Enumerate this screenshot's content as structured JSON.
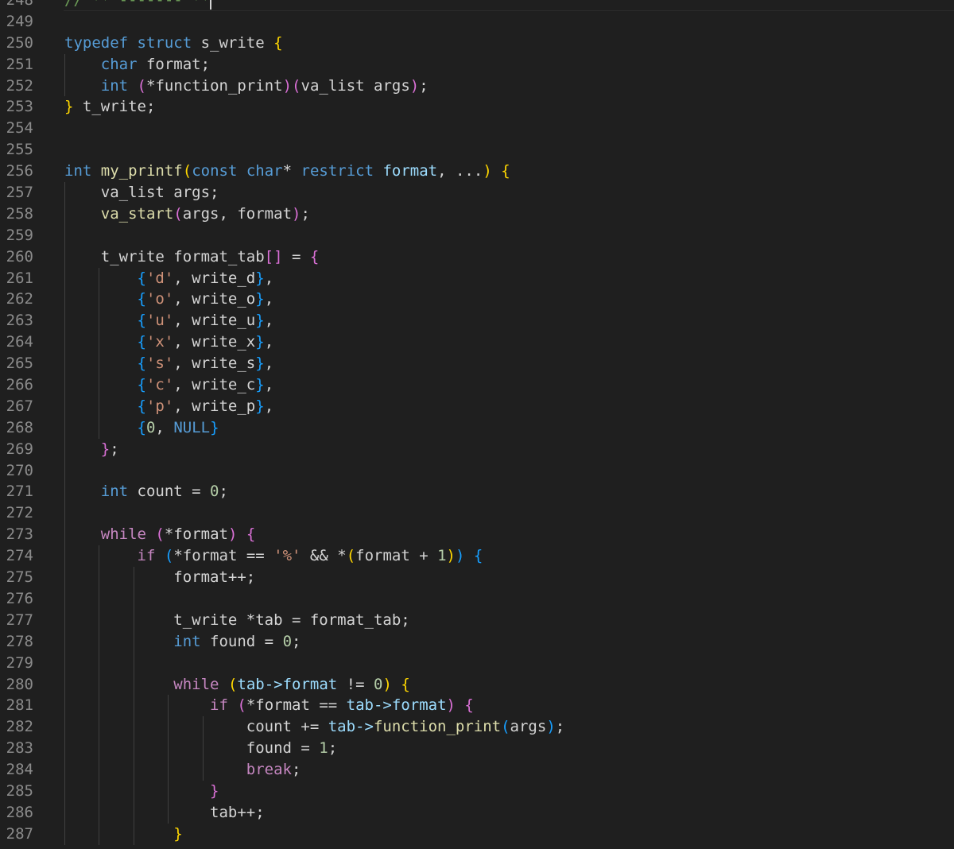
{
  "editor": {
    "language": "c",
    "cursor_line": "248",
    "lines": [
      {
        "num": "248",
        "indent": 0,
        "tokens": [
          {
            "t": "// ** ------- **",
            "c": "cm"
          }
        ]
      },
      {
        "num": "249",
        "indent": 0,
        "tokens": []
      },
      {
        "num": "250",
        "indent": 0,
        "tokens": [
          {
            "t": "typedef",
            "c": "kw"
          },
          {
            "t": " "
          },
          {
            "t": "struct",
            "c": "kw"
          },
          {
            "t": " s_write "
          },
          {
            "t": "{",
            "c": "br1"
          }
        ]
      },
      {
        "num": "251",
        "indent": 1,
        "tokens": [
          {
            "t": "char",
            "c": "kw"
          },
          {
            "t": " format;"
          }
        ]
      },
      {
        "num": "252",
        "indent": 1,
        "tokens": [
          {
            "t": "int",
            "c": "kw"
          },
          {
            "t": " "
          },
          {
            "t": "(",
            "c": "br2"
          },
          {
            "t": "*function_print"
          },
          {
            "t": ")",
            "c": "br2"
          },
          {
            "t": "(",
            "c": "br2"
          },
          {
            "t": "va_list args"
          },
          {
            "t": ")",
            "c": "br2"
          },
          {
            "t": ";"
          }
        ]
      },
      {
        "num": "253",
        "indent": 0,
        "tokens": [
          {
            "t": "}",
            "c": "br1"
          },
          {
            "t": " t_write;"
          }
        ]
      },
      {
        "num": "254",
        "indent": 0,
        "tokens": []
      },
      {
        "num": "255",
        "indent": 0,
        "tokens": []
      },
      {
        "num": "256",
        "indent": 0,
        "tokens": [
          {
            "t": "int",
            "c": "kw"
          },
          {
            "t": " "
          },
          {
            "t": "my_printf",
            "c": "fn"
          },
          {
            "t": "(",
            "c": "br1"
          },
          {
            "t": "const",
            "c": "kw"
          },
          {
            "t": " "
          },
          {
            "t": "char",
            "c": "kw"
          },
          {
            "t": "* "
          },
          {
            "t": "restrict",
            "c": "kw"
          },
          {
            "t": " "
          },
          {
            "t": "format",
            "c": "mem"
          },
          {
            "t": ", ..."
          },
          {
            "t": ")",
            "c": "br1"
          },
          {
            "t": " "
          },
          {
            "t": "{",
            "c": "br1"
          }
        ]
      },
      {
        "num": "257",
        "indent": 1,
        "tokens": [
          {
            "t": "va_list args;"
          }
        ]
      },
      {
        "num": "258",
        "indent": 1,
        "tokens": [
          {
            "t": "va_start",
            "c": "fn"
          },
          {
            "t": "(",
            "c": "br2"
          },
          {
            "t": "args, format"
          },
          {
            "t": ")",
            "c": "br2"
          },
          {
            "t": ";"
          }
        ]
      },
      {
        "num": "259",
        "indent": 0,
        "tokens": []
      },
      {
        "num": "260",
        "indent": 1,
        "tokens": [
          {
            "t": "t_write format_tab"
          },
          {
            "t": "[]",
            "c": "br2"
          },
          {
            "t": " = "
          },
          {
            "t": "{",
            "c": "br2"
          }
        ]
      },
      {
        "num": "261",
        "indent": 2,
        "tokens": [
          {
            "t": "{",
            "c": "br3"
          },
          {
            "t": "'d'",
            "c": "str"
          },
          {
            "t": ", write_d"
          },
          {
            "t": "}",
            "c": "br3"
          },
          {
            "t": ","
          }
        ]
      },
      {
        "num": "262",
        "indent": 2,
        "tokens": [
          {
            "t": "{",
            "c": "br3"
          },
          {
            "t": "'o'",
            "c": "str"
          },
          {
            "t": ", write_o"
          },
          {
            "t": "}",
            "c": "br3"
          },
          {
            "t": ","
          }
        ]
      },
      {
        "num": "263",
        "indent": 2,
        "tokens": [
          {
            "t": "{",
            "c": "br3"
          },
          {
            "t": "'u'",
            "c": "str"
          },
          {
            "t": ", write_u"
          },
          {
            "t": "}",
            "c": "br3"
          },
          {
            "t": ","
          }
        ]
      },
      {
        "num": "264",
        "indent": 2,
        "tokens": [
          {
            "t": "{",
            "c": "br3"
          },
          {
            "t": "'x'",
            "c": "str"
          },
          {
            "t": ", write_x"
          },
          {
            "t": "}",
            "c": "br3"
          },
          {
            "t": ","
          }
        ]
      },
      {
        "num": "265",
        "indent": 2,
        "tokens": [
          {
            "t": "{",
            "c": "br3"
          },
          {
            "t": "'s'",
            "c": "str"
          },
          {
            "t": ", write_s"
          },
          {
            "t": "}",
            "c": "br3"
          },
          {
            "t": ","
          }
        ]
      },
      {
        "num": "266",
        "indent": 2,
        "tokens": [
          {
            "t": "{",
            "c": "br3"
          },
          {
            "t": "'c'",
            "c": "str"
          },
          {
            "t": ", write_c"
          },
          {
            "t": "}",
            "c": "br3"
          },
          {
            "t": ","
          }
        ]
      },
      {
        "num": "267",
        "indent": 2,
        "tokens": [
          {
            "t": "{",
            "c": "br3"
          },
          {
            "t": "'p'",
            "c": "str"
          },
          {
            "t": ", write_p"
          },
          {
            "t": "}",
            "c": "br3"
          },
          {
            "t": ","
          }
        ]
      },
      {
        "num": "268",
        "indent": 2,
        "tokens": [
          {
            "t": "{",
            "c": "br3"
          },
          {
            "t": "0",
            "c": "num"
          },
          {
            "t": ", "
          },
          {
            "t": "NULL",
            "c": "kw"
          },
          {
            "t": "}",
            "c": "br3"
          }
        ]
      },
      {
        "num": "269",
        "indent": 1,
        "tokens": [
          {
            "t": "}",
            "c": "br2"
          },
          {
            "t": ";"
          }
        ]
      },
      {
        "num": "270",
        "indent": 0,
        "tokens": []
      },
      {
        "num": "271",
        "indent": 1,
        "tokens": [
          {
            "t": "int",
            "c": "kw"
          },
          {
            "t": " count = "
          },
          {
            "t": "0",
            "c": "num"
          },
          {
            "t": ";"
          }
        ]
      },
      {
        "num": "272",
        "indent": 0,
        "tokens": []
      },
      {
        "num": "273",
        "indent": 1,
        "tokens": [
          {
            "t": "while",
            "c": "ctl"
          },
          {
            "t": " "
          },
          {
            "t": "(",
            "c": "br2"
          },
          {
            "t": "*format"
          },
          {
            "t": ")",
            "c": "br2"
          },
          {
            "t": " "
          },
          {
            "t": "{",
            "c": "br2"
          }
        ]
      },
      {
        "num": "274",
        "indent": 2,
        "tokens": [
          {
            "t": "if",
            "c": "ctl"
          },
          {
            "t": " "
          },
          {
            "t": "(",
            "c": "br3"
          },
          {
            "t": "*format == "
          },
          {
            "t": "'%'",
            "c": "str"
          },
          {
            "t": " && *"
          },
          {
            "t": "(",
            "c": "br1"
          },
          {
            "t": "format + "
          },
          {
            "t": "1",
            "c": "num"
          },
          {
            "t": ")",
            "c": "br1"
          },
          {
            "t": ")",
            "c": "br3"
          },
          {
            "t": " "
          },
          {
            "t": "{",
            "c": "br3"
          }
        ]
      },
      {
        "num": "275",
        "indent": 3,
        "tokens": [
          {
            "t": "format++;"
          }
        ]
      },
      {
        "num": "276",
        "indent": 0,
        "tokens": []
      },
      {
        "num": "277",
        "indent": 3,
        "tokens": [
          {
            "t": "t_write *tab = format_tab;"
          }
        ]
      },
      {
        "num": "278",
        "indent": 3,
        "tokens": [
          {
            "t": "int",
            "c": "kw"
          },
          {
            "t": " found = "
          },
          {
            "t": "0",
            "c": "num"
          },
          {
            "t": ";"
          }
        ]
      },
      {
        "num": "279",
        "indent": 0,
        "tokens": []
      },
      {
        "num": "280",
        "indent": 3,
        "tokens": [
          {
            "t": "while",
            "c": "ctl"
          },
          {
            "t": " "
          },
          {
            "t": "(",
            "c": "br1"
          },
          {
            "t": "tab->",
            "c": "mem"
          },
          {
            "t": "format",
            "c": "mem"
          },
          {
            "t": " != "
          },
          {
            "t": "0",
            "c": "num"
          },
          {
            "t": ")",
            "c": "br1"
          },
          {
            "t": " "
          },
          {
            "t": "{",
            "c": "br1"
          }
        ]
      },
      {
        "num": "281",
        "indent": 4,
        "tokens": [
          {
            "t": "if",
            "c": "ctl"
          },
          {
            "t": " "
          },
          {
            "t": "(",
            "c": "br2"
          },
          {
            "t": "*format == "
          },
          {
            "t": "tab->",
            "c": "mem"
          },
          {
            "t": "format",
            "c": "mem"
          },
          {
            "t": ")",
            "c": "br2"
          },
          {
            "t": " "
          },
          {
            "t": "{",
            "c": "br2"
          }
        ]
      },
      {
        "num": "282",
        "indent": 5,
        "tokens": [
          {
            "t": "count += "
          },
          {
            "t": "tab->",
            "c": "mem"
          },
          {
            "t": "function_print",
            "c": "fn"
          },
          {
            "t": "(",
            "c": "br3"
          },
          {
            "t": "args"
          },
          {
            "t": ")",
            "c": "br3"
          },
          {
            "t": ";"
          }
        ]
      },
      {
        "num": "283",
        "indent": 5,
        "tokens": [
          {
            "t": "found = "
          },
          {
            "t": "1",
            "c": "num"
          },
          {
            "t": ";"
          }
        ]
      },
      {
        "num": "284",
        "indent": 5,
        "tokens": [
          {
            "t": "break",
            "c": "ctl"
          },
          {
            "t": ";"
          }
        ]
      },
      {
        "num": "285",
        "indent": 4,
        "tokens": [
          {
            "t": "}",
            "c": "br2"
          }
        ]
      },
      {
        "num": "286",
        "indent": 4,
        "tokens": [
          {
            "t": "tab++;"
          }
        ]
      },
      {
        "num": "287",
        "indent": 3,
        "tokens": [
          {
            "t": "}",
            "c": "br1"
          }
        ]
      }
    ],
    "guides": [
      {
        "depth": 0,
        "from": "251",
        "to": "252"
      },
      {
        "depth": 0,
        "from": "257",
        "to": "287"
      },
      {
        "depth": 1,
        "from": "261",
        "to": "268"
      },
      {
        "depth": 1,
        "from": "274",
        "to": "287"
      },
      {
        "depth": 2,
        "from": "275",
        "to": "287"
      },
      {
        "depth": 3,
        "from": "281",
        "to": "286"
      },
      {
        "depth": 4,
        "from": "282",
        "to": "284"
      }
    ]
  }
}
